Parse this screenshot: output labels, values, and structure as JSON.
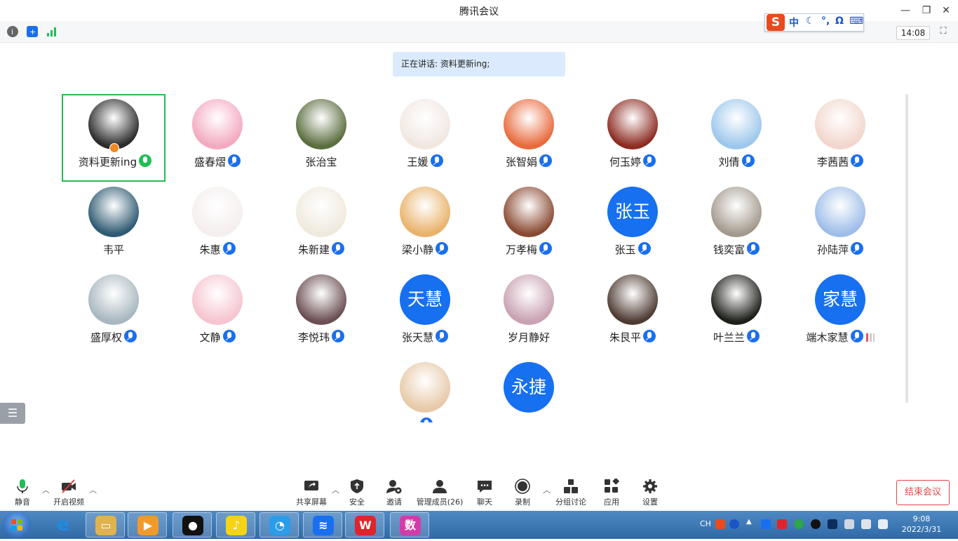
{
  "window": {
    "title": "腾讯会议",
    "clock": "14:08"
  },
  "ime": {
    "logo": "S",
    "mode": "中",
    "items": [
      "☾",
      "°,",
      "Ω",
      "⌨"
    ]
  },
  "speaker_banner": "正在讲话: 资料更新ing;",
  "participants": [
    {
      "name": "资料更新ing",
      "avatar": "photo",
      "color": "#2b2b2b",
      "mic": "on",
      "active": true
    },
    {
      "name": "盛春熠",
      "avatar": "photo",
      "color": "#f3a9c0",
      "mic": "muted"
    },
    {
      "name": "张治宝",
      "avatar": "photo",
      "color": "#5b6e3f",
      "mic": "none"
    },
    {
      "name": "王媛",
      "avatar": "photo",
      "color": "#f1e7e1",
      "mic": "muted"
    },
    {
      "name": "张智娟",
      "avatar": "photo",
      "color": "#e86a3c",
      "mic": "muted"
    },
    {
      "name": "何玉婷",
      "avatar": "photo",
      "color": "#8c2c22",
      "mic": "muted"
    },
    {
      "name": "刘倩",
      "avatar": "photo",
      "color": "#9cc7ec",
      "mic": "muted"
    },
    {
      "name": "李茜茜",
      "avatar": "photo",
      "color": "#f2d6cc",
      "mic": "muted"
    },
    {
      "name": "韦平",
      "avatar": "photo",
      "color": "#2e5a72",
      "mic": "none"
    },
    {
      "name": "朱惠",
      "avatar": "photo",
      "color": "#f5eeee",
      "mic": "muted"
    },
    {
      "name": "朱新建",
      "avatar": "photo",
      "color": "#f0e9dd",
      "mic": "muted"
    },
    {
      "name": "梁小静",
      "avatar": "photo",
      "color": "#e9b26a",
      "mic": "muted"
    },
    {
      "name": "万孝梅",
      "avatar": "photo",
      "color": "#8a4a32",
      "mic": "muted"
    },
    {
      "name": "张玉",
      "avatar": "text",
      "initials": "张玉",
      "color": "#1670f0",
      "mic": "muted"
    },
    {
      "name": "钱奕富",
      "avatar": "photo",
      "color": "#a39a8e",
      "mic": "muted"
    },
    {
      "name": "孙陆萍",
      "avatar": "photo",
      "color": "#9dbde8",
      "mic": "muted"
    },
    {
      "name": "盛厚权",
      "avatar": "photo",
      "color": "#a8b7bf",
      "mic": "muted"
    },
    {
      "name": "文静",
      "avatar": "photo",
      "color": "#f6c4cf",
      "mic": "muted"
    },
    {
      "name": "李悦玮",
      "avatar": "photo",
      "color": "#6b4f52",
      "mic": "muted"
    },
    {
      "name": "张天慧",
      "avatar": "text",
      "initials": "天慧",
      "color": "#1670f0",
      "mic": "muted"
    },
    {
      "name": "岁月静好",
      "avatar": "photo",
      "color": "#c9a1b2",
      "mic": "none"
    },
    {
      "name": "朱艮平",
      "avatar": "photo",
      "color": "#4e3a32",
      "mic": "muted"
    },
    {
      "name": "叶兰兰",
      "avatar": "photo",
      "color": "#1d1f1a",
      "mic": "muted"
    },
    {
      "name": "端木家慧",
      "avatar": "text",
      "initials": "家慧",
      "color": "#1670f0",
      "mic": "muted",
      "signal": true
    },
    {
      "name": "",
      "avatar": "photo",
      "color": "#e7c9a8",
      "mic": "muted"
    },
    {
      "name": "",
      "avatar": "text",
      "initials": "永捷",
      "color": "#1670f0",
      "mic": "none"
    }
  ],
  "toolbar": {
    "mute": "静音",
    "video": "开启视频",
    "share": "共享屏幕",
    "security": "安全",
    "invite": "邀请",
    "members": "管理成员(26)",
    "chat": "聊天",
    "record": "录制",
    "breakout": "分组讨论",
    "apps": "应用",
    "settings": "设置",
    "end": "结束会议"
  },
  "taskbar": {
    "apps": [
      {
        "name": "ie",
        "glyph": "e",
        "color": "#1e8be0"
      },
      {
        "name": "explorer",
        "glyph": "▭",
        "color": "#e0b350"
      },
      {
        "name": "player",
        "glyph": "▶",
        "color": "#f19a2b"
      },
      {
        "name": "qq",
        "glyph": "●",
        "color": "#111111"
      },
      {
        "name": "qqmusic",
        "glyph": "♪",
        "color": "#f5d316"
      },
      {
        "name": "browser",
        "glyph": "◔",
        "color": "#2d9ce8"
      },
      {
        "name": "tencent-meeting",
        "glyph": "≋",
        "color": "#1a6ff0"
      },
      {
        "name": "wps",
        "glyph": "W",
        "color": "#e2232a"
      },
      {
        "name": "shu",
        "glyph": "数",
        "color": "#d33ca8"
      }
    ],
    "lang": "CH",
    "time": "9:08",
    "date": "2022/3/31"
  }
}
